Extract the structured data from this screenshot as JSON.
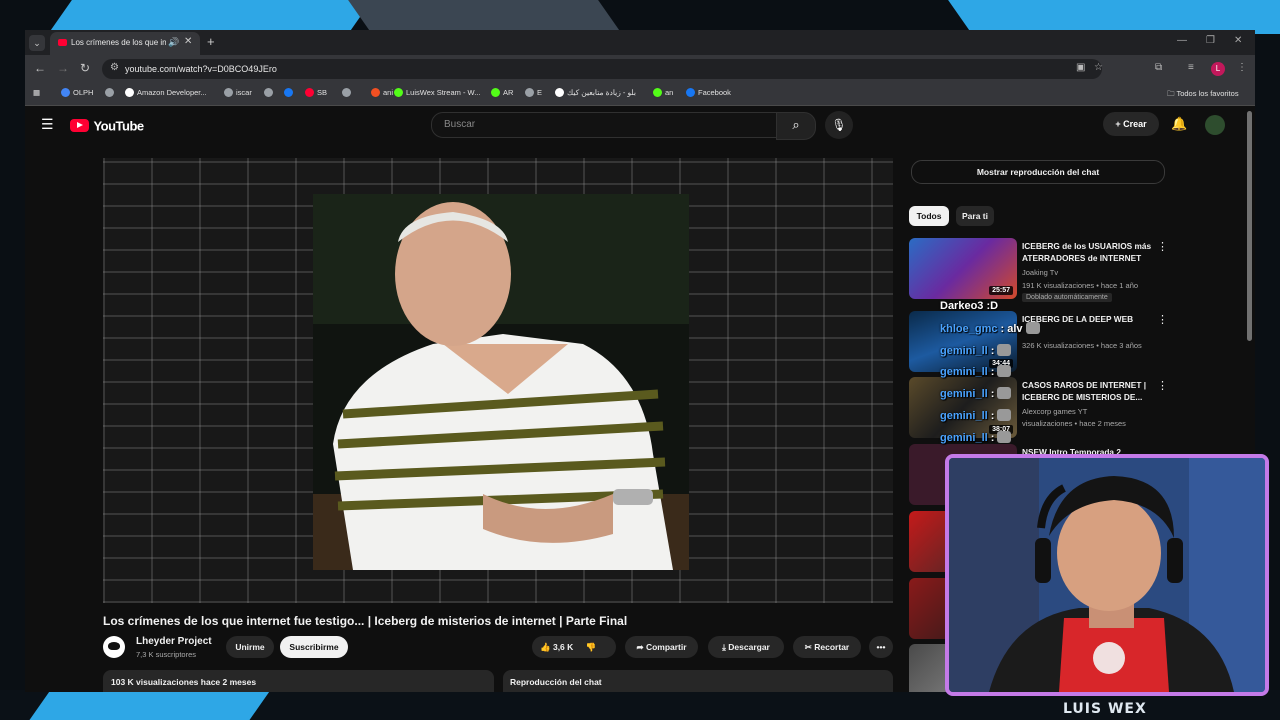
{
  "browser": {
    "tab_title": "Los crímenes de los que inte",
    "url": "youtube.com/watch?v=D0BCO49JEro",
    "bookmarks": [
      {
        "label": "OLPH",
        "icon": "google-icon",
        "color": "#4285f4"
      },
      {
        "label": "",
        "icon": "globe-icon",
        "color": "#9aa0a6"
      },
      {
        "label": "Amazon Developer...",
        "icon": "amazon-icon",
        "color": "#ffffff"
      },
      {
        "label": "iscar",
        "icon": "globe-icon",
        "color": "#9aa0a6"
      },
      {
        "label": "",
        "icon": "globe-icon",
        "color": "#9aa0a6"
      },
      {
        "label": "",
        "icon": "facebook-icon",
        "color": "#1877f2"
      },
      {
        "label": "SB",
        "icon": "youtube-icon",
        "color": "#ff0033"
      },
      {
        "label": "",
        "icon": "globe-icon",
        "color": "#9aa0a6"
      },
      {
        "label": "ani",
        "icon": "microsoft-icon",
        "color": "#f25022"
      },
      {
        "label": "LuisWex Stream - W...",
        "icon": "kick-icon",
        "color": "#53fc18"
      },
      {
        "label": "AR",
        "icon": "kick-icon",
        "color": "#53fc18"
      },
      {
        "label": "E",
        "icon": "refresh-icon",
        "color": "#9aa0a6"
      },
      {
        "label": "بلو - زيادة متابعين كيك",
        "icon": "circle-icon",
        "color": "#ffffff"
      },
      {
        "label": "an",
        "icon": "kick-icon",
        "color": "#53fc18"
      },
      {
        "label": "Facebook",
        "icon": "facebook-icon",
        "color": "#1877f2"
      }
    ],
    "all_bookmarks": "Todos los favoritos"
  },
  "youtube": {
    "logo_text": "YouTube",
    "search_placeholder": "Buscar",
    "create_label": "Crear",
    "video_title": "Los crímenes de los que internet fue testigo... | Iceberg de misterios de internet | Parte Final",
    "channel_name": "Lheyder Project",
    "channel_subs": "7,3 K suscriptores",
    "join_label": "Unirme",
    "subscribe_label": "Suscribirme",
    "likes": "3,6 K",
    "share_label": "Compartir",
    "download_label": "Descargar",
    "clip_label": "Recortar",
    "description_views": "103 K visualizaciones  hace 2 meses",
    "chat_replay_label": "Reproducción del chat",
    "show_chat_replay": "Mostrar reproducción del chat",
    "chips": [
      "Todos",
      "Para ti"
    ],
    "recommendations": [
      {
        "title": "ICEBERG de los USUARIOS más ATERRADORES de INTERNET",
        "channel": "Joaking Tv",
        "meta": "191 K visualizaciones • hace 1 año",
        "duration": "25:57",
        "badge": "Doblado automáticamente"
      },
      {
        "title": "ICEBERG DE LA DEEP WEB",
        "channel": "",
        "meta": "326 K visualizaciones • hace 3 años",
        "duration": "34:44",
        "badge": ""
      },
      {
        "title": "CASOS RAROS DE INTERNET | ICEBERG DE MISTERIOS DE...",
        "channel": "Alexcorp games YT",
        "meta": "visualizaciones • hace 2 meses",
        "duration": "38:07",
        "badge": ""
      },
      {
        "title": "NSEW Intro Temporada 2",
        "channel": "",
        "meta": "",
        "duration": "",
        "badge": ""
      }
    ]
  },
  "chat_overlay": [
    {
      "user": "Darkeo3",
      "text": ":D"
    },
    {
      "user": "khloe_gmc",
      "text": ": alv"
    },
    {
      "user": "gemini_ll",
      "text": ":"
    },
    {
      "user": "gemini_ll",
      "text": ":"
    },
    {
      "user": "gemini_ll",
      "text": ":"
    },
    {
      "user": "gemini_ll",
      "text": ":"
    },
    {
      "user": "gemini_ll",
      "text": ":"
    }
  ],
  "streamer": "LUIS WEX",
  "colors": {
    "accent_red": "#ff0033",
    "frame_purple": "#c47ae8",
    "stream_blue": "#2ea7e6"
  }
}
